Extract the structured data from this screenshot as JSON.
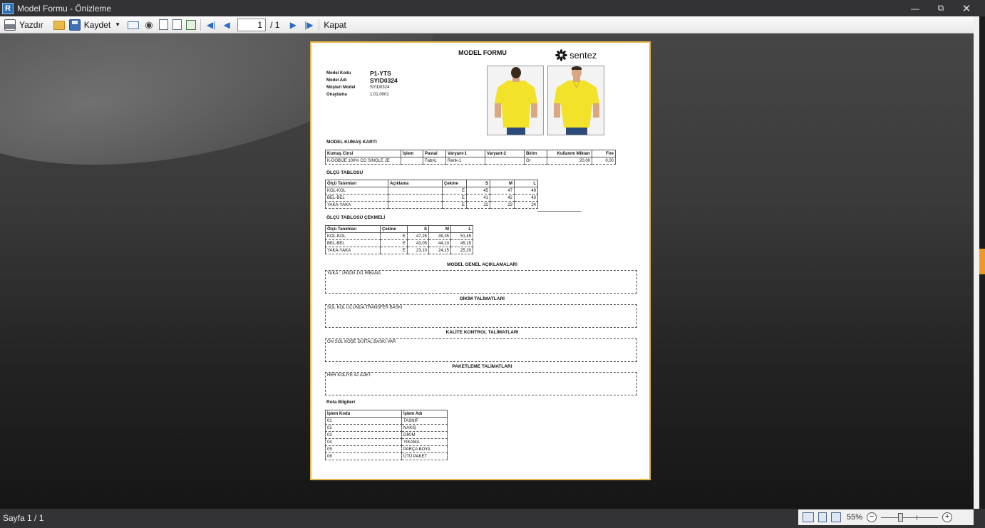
{
  "window": {
    "title": "Model Formu - Önizleme"
  },
  "toolbar": {
    "print_label": "Yazdır",
    "save_label": "Kaydet",
    "page_current": "1",
    "page_total": "/ 1",
    "close_label": "Kapat"
  },
  "document": {
    "title": "MODEL FORMU",
    "logo_text": "sentez",
    "model_info": [
      {
        "label": "Model Kodu",
        "value": "P1-YTS"
      },
      {
        "label": "Model Adı",
        "value": "SYID0324"
      },
      {
        "label": "Müşteri Model",
        "value": "SYID0324"
      },
      {
        "label": "Onaylama",
        "value": "1.01.0001"
      }
    ],
    "fabric_section": "MODEL KUMAŞ KARTI",
    "fabric_headers": [
      "Kumaş Cinsi",
      "İşlem",
      "Pastal",
      "Varyant-1",
      "Varyant-2",
      "Birim",
      "Kullanım Miktarı",
      "Fire"
    ],
    "fabric_rows": [
      [
        "K-DOBIJE 100% CO SINGLE JE",
        "",
        "Fabric",
        "Renk-1",
        "",
        "Gr",
        "20,00",
        "0,00"
      ]
    ],
    "size_section": "ÖLÇÜ TABLOSU",
    "size_headers": [
      "Ölçü Tanımları",
      "Açıklama",
      "Çekme",
      "S",
      "M",
      "L"
    ],
    "size_rows": [
      [
        "KOL-KOL",
        "",
        "E",
        "45",
        "47",
        "49"
      ],
      [
        "BEL-BEL",
        "",
        "E",
        "41",
        "42",
        "43"
      ],
      [
        "YAKA-YAKA",
        "",
        "E",
        "22",
        "23",
        "24"
      ]
    ],
    "shrink_section": "ÖLÇÜ TABLOSU ÇEKMELİ",
    "shrink_headers": [
      "Ölçü Tanımları",
      "Çekme",
      "S",
      "M",
      "L"
    ],
    "shrink_rows": [
      [
        "KOL-KOL",
        "E",
        "47,25",
        "49,35",
        "51,45"
      ],
      [
        "BEL-BEL",
        "E",
        "43,05",
        "44,10",
        "45,15"
      ],
      [
        "YAKA-YAKA",
        "E",
        "23,10",
        "24,15",
        "25,20"
      ]
    ],
    "notes": [
      {
        "title": "MODEL GENEL AÇIKLAMALARI",
        "text": "YAKA : 150DN 1X1 RİBANA"
      },
      {
        "title": "DİKİM TALİMATLARI",
        "text": "SOL KOL UCUNDA TRANSFER BASKI"
      },
      {
        "title": "KALİTE KONTROL TALİMATLARI",
        "text": "ÖN SOL KÖŞE DİJİTAL BASKI VAR"
      },
      {
        "title": "PAKETLEME TALİMATLARI",
        "text": "HER KOLİYE 42 ADET"
      }
    ],
    "route_section": "Rota Bilgileri",
    "route_headers": [
      "İşlem Kodu",
      "İşlem Adı"
    ],
    "route_rows": [
      [
        "01",
        "TASNİF"
      ],
      [
        "02",
        "NAKIŞ"
      ],
      [
        "03",
        "DİKİM"
      ],
      [
        "04",
        "YIKAMA"
      ],
      [
        "05",
        "PARÇA BOYA"
      ],
      [
        "06",
        "ÜTÜ PAKET"
      ]
    ]
  },
  "statusbar": {
    "page_text": "Sayfa 1 / 1",
    "zoom": "55%"
  },
  "colors": {
    "chrome": "#333336",
    "page_border": "#e8b54a",
    "shirt": "#f2e22a",
    "nav_arrow": "#2c6bc4"
  },
  "icons": [
    "print-icon",
    "open-icon",
    "save-icon",
    "email-icon",
    "find-icon",
    "page-setup-icon",
    "first-page-icon",
    "prev-page-icon",
    "next-page-icon",
    "last-page-icon"
  ]
}
